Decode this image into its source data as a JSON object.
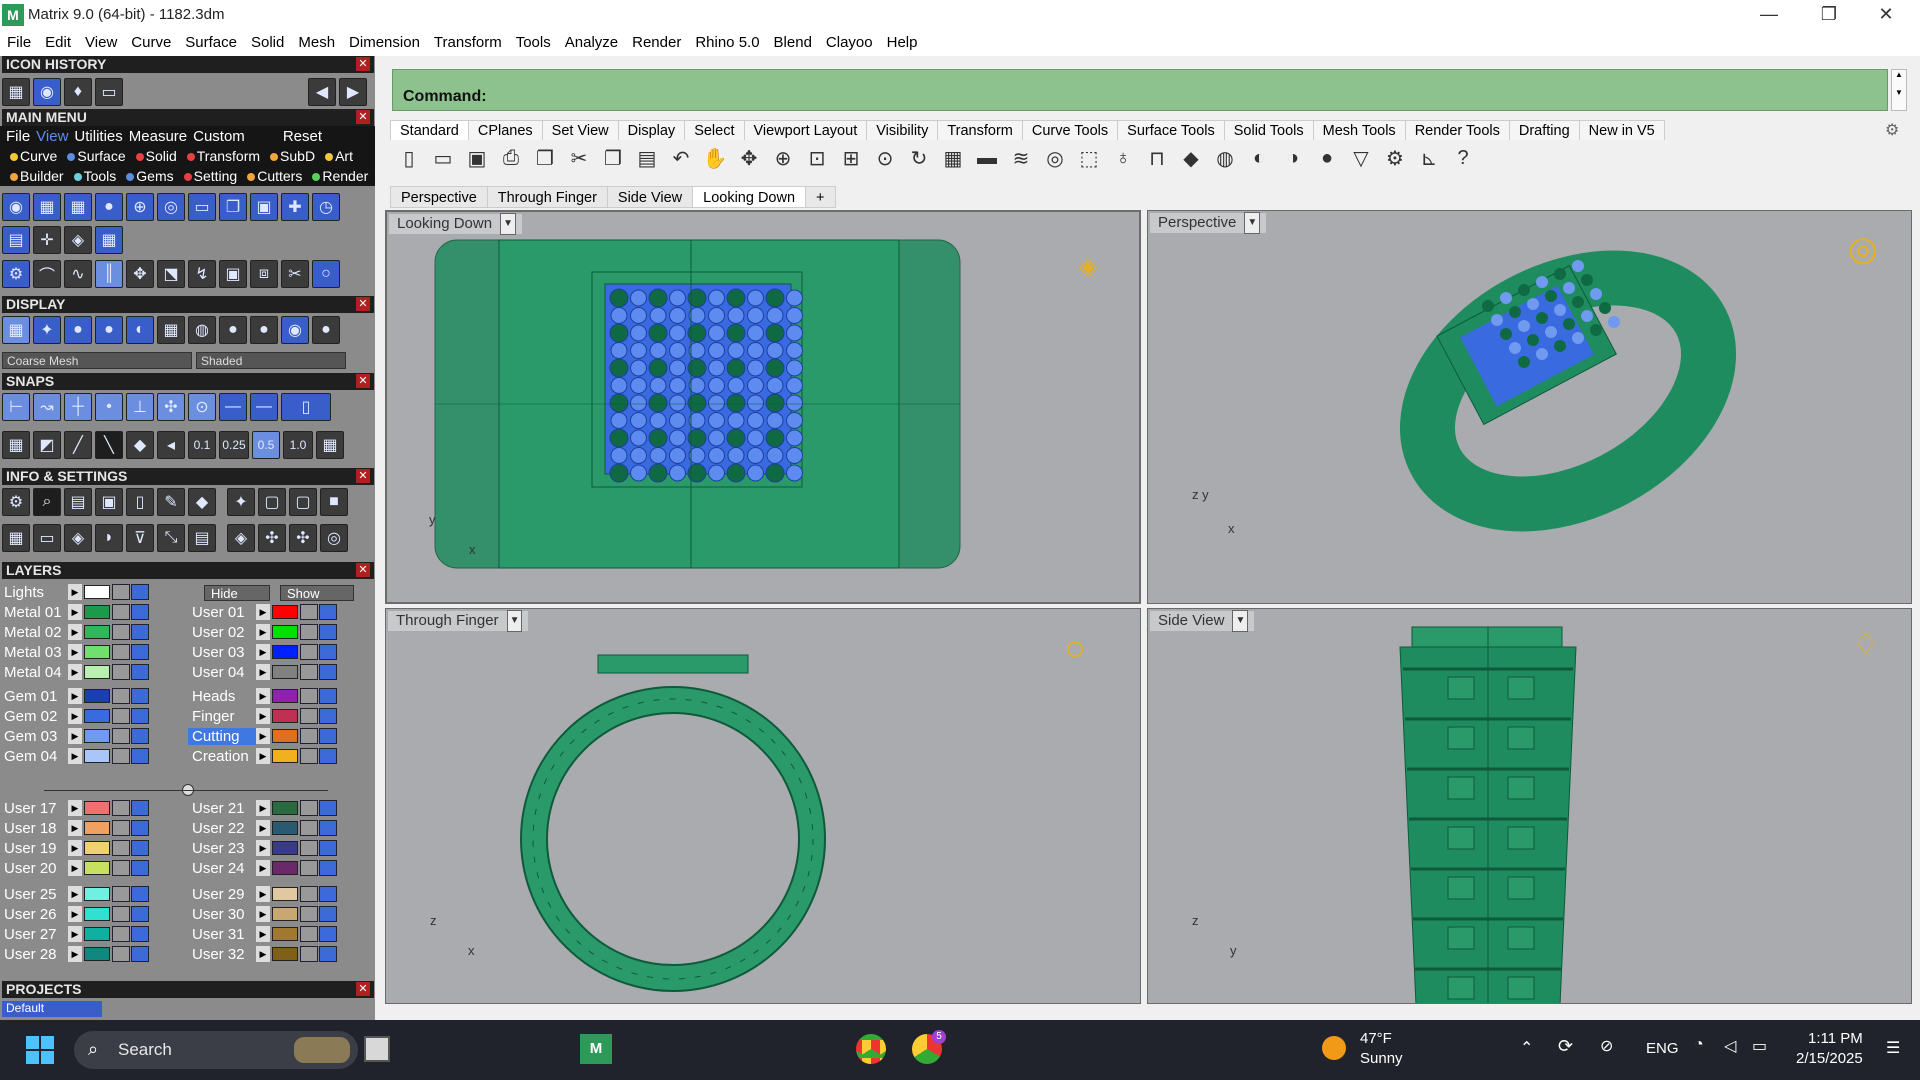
{
  "window": {
    "title": "Matrix 9.0 (64-bit) - 1182.3dm",
    "min": "—",
    "max": "❐",
    "close": "✕"
  },
  "menubar": [
    "File",
    "Edit",
    "View",
    "Curve",
    "Surface",
    "Solid",
    "Mesh",
    "Dimension",
    "Transform",
    "Tools",
    "Analyze",
    "Render",
    "Rhino 5.0",
    "Blend",
    "Clayoo",
    "Help"
  ],
  "left": {
    "icon_history": "ICON HISTORY",
    "main_menu": "MAIN MENU",
    "mm_row1": [
      "File",
      "View",
      "Utilities",
      "Measure",
      "Custom",
      "Reset"
    ],
    "mm_row2": [
      {
        "t": "Curve",
        "c": "#f3c63c"
      },
      {
        "t": "Surface",
        "c": "#5c8de0"
      },
      {
        "t": "Solid",
        "c": "#e64040"
      },
      {
        "t": "Transform",
        "c": "#e64040"
      },
      {
        "t": "SubD",
        "c": "#f3a53c"
      },
      {
        "t": "Art",
        "c": "#f3c63c"
      }
    ],
    "mm_row3": [
      {
        "t": "Builder",
        "c": "#f3a53c"
      },
      {
        "t": "Tools",
        "c": "#6ad0e0"
      },
      {
        "t": "Gems",
        "c": "#5c8de0"
      },
      {
        "t": "Setting",
        "c": "#e64040"
      },
      {
        "t": "Cutters",
        "c": "#f3a53c"
      },
      {
        "t": "Render",
        "c": "#5ad05a"
      }
    ],
    "display": "DISPLAY",
    "mesh_dropdown": "Coarse Mesh",
    "shade_dropdown": "Shaded",
    "snaps": "SNAPS",
    "snap_values": [
      "0.1",
      "0.25",
      "0.5",
      "1.0"
    ],
    "info": "INFO & SETTINGS",
    "layers_hdr": "LAYERS",
    "lights": "Lights",
    "hide": "Hide",
    "show": "Show",
    "layers_left": [
      {
        "n": "Metal 01",
        "c": "#1c9a4a"
      },
      {
        "n": "Metal 02",
        "c": "#2fb85a"
      },
      {
        "n": "Metal 03",
        "c": "#6fe070"
      },
      {
        "n": "Metal 04",
        "c": "#b8f0b0"
      },
      {
        "n": "Gem 01",
        "c": "#1a3fb0"
      },
      {
        "n": "Gem 02",
        "c": "#3a6ae0"
      },
      {
        "n": "Gem 03",
        "c": "#6f9af0"
      },
      {
        "n": "Gem 04",
        "c": "#a8c6f8"
      },
      {
        "n": "User 17",
        "c": "#f07070"
      },
      {
        "n": "User 18",
        "c": "#f0a060"
      },
      {
        "n": "User 19",
        "c": "#f0d070"
      },
      {
        "n": "User 20",
        "c": "#c8e060"
      },
      {
        "n": "User 25",
        "c": "#70f0e0"
      },
      {
        "n": "User 26",
        "c": "#30e0d0"
      },
      {
        "n": "User 27",
        "c": "#10b0a0"
      },
      {
        "n": "User 28",
        "c": "#108880"
      }
    ],
    "layers_right": [
      {
        "n": "User 01",
        "c": "#ff0000"
      },
      {
        "n": "User 02",
        "c": "#00e000"
      },
      {
        "n": "User 03",
        "c": "#0020ff"
      },
      {
        "n": "User 04",
        "c": "#808080"
      },
      {
        "n": "Heads",
        "c": "#9020b0"
      },
      {
        "n": "Finger",
        "c": "#c03050"
      },
      {
        "n": "Cutting",
        "c": "#e07020"
      },
      {
        "n": "Creation",
        "c": "#f0b020"
      },
      {
        "n": "User 21",
        "c": "#2a6a40"
      },
      {
        "n": "User 22",
        "c": "#2a5a70"
      },
      {
        "n": "User 23",
        "c": "#3a3a8a"
      },
      {
        "n": "User 24",
        "c": "#6a2a6a"
      },
      {
        "n": "User 29",
        "c": "#e0c8a0"
      },
      {
        "n": "User 30",
        "c": "#c8a870"
      },
      {
        "n": "User 31",
        "c": "#a07830"
      },
      {
        "n": "User 32",
        "c": "#806018"
      }
    ],
    "projects": "PROJECTS",
    "default": "Default"
  },
  "command": {
    "label": "Command:",
    "value": ""
  },
  "toolbar_tabs": [
    "Standard",
    "CPlanes",
    "Set View",
    "Display",
    "Select",
    "Viewport Layout",
    "Visibility",
    "Transform",
    "Curve Tools",
    "Surface Tools",
    "Solid Tools",
    "Mesh Tools",
    "Render Tools",
    "Drafting",
    "New in V5"
  ],
  "toolbar_icons": [
    "new-file",
    "open",
    "save",
    "print",
    "import",
    "cut",
    "copy",
    "paste",
    "undo",
    "pan",
    "rotate",
    "zoom",
    "zoom-window",
    "zoom-extents",
    "zoom-selected",
    "rotate-view",
    "four-viewports",
    "car",
    "zebra",
    "circle-target",
    "snap",
    "bulb",
    "lock",
    "layer",
    "color-wheel",
    "sphere-render",
    "shaded-sphere",
    "blue-sphere",
    "funnel",
    "gear",
    "dimension",
    "help"
  ],
  "viewport_tabs": [
    "Perspective",
    "Through Finger",
    "Side View",
    "Looking Down",
    "+"
  ],
  "viewports": {
    "top_left": {
      "label": "Looking Down",
      "axis1": "y",
      "axis2": "x"
    },
    "top_right": {
      "label": "Perspective",
      "axis1": "z",
      "axis2": "y",
      "axis3": "x"
    },
    "bottom_left": {
      "label": "Through Finger",
      "axis1": "z",
      "axis2": "x"
    },
    "bottom_right": {
      "label": "Side View",
      "axis1": "z",
      "axis2": "y"
    }
  },
  "taskbar": {
    "search": "Search",
    "weather_temp": "47°F",
    "weather_text": "Sunny",
    "lang": "ENG",
    "time": "1:11 PM",
    "date": "2/15/2025",
    "badge": "5"
  },
  "colors": {
    "accent_green": "#1f8c60",
    "gem_blue": "#3a6ae0",
    "cmd_green": "#8dc18d"
  }
}
